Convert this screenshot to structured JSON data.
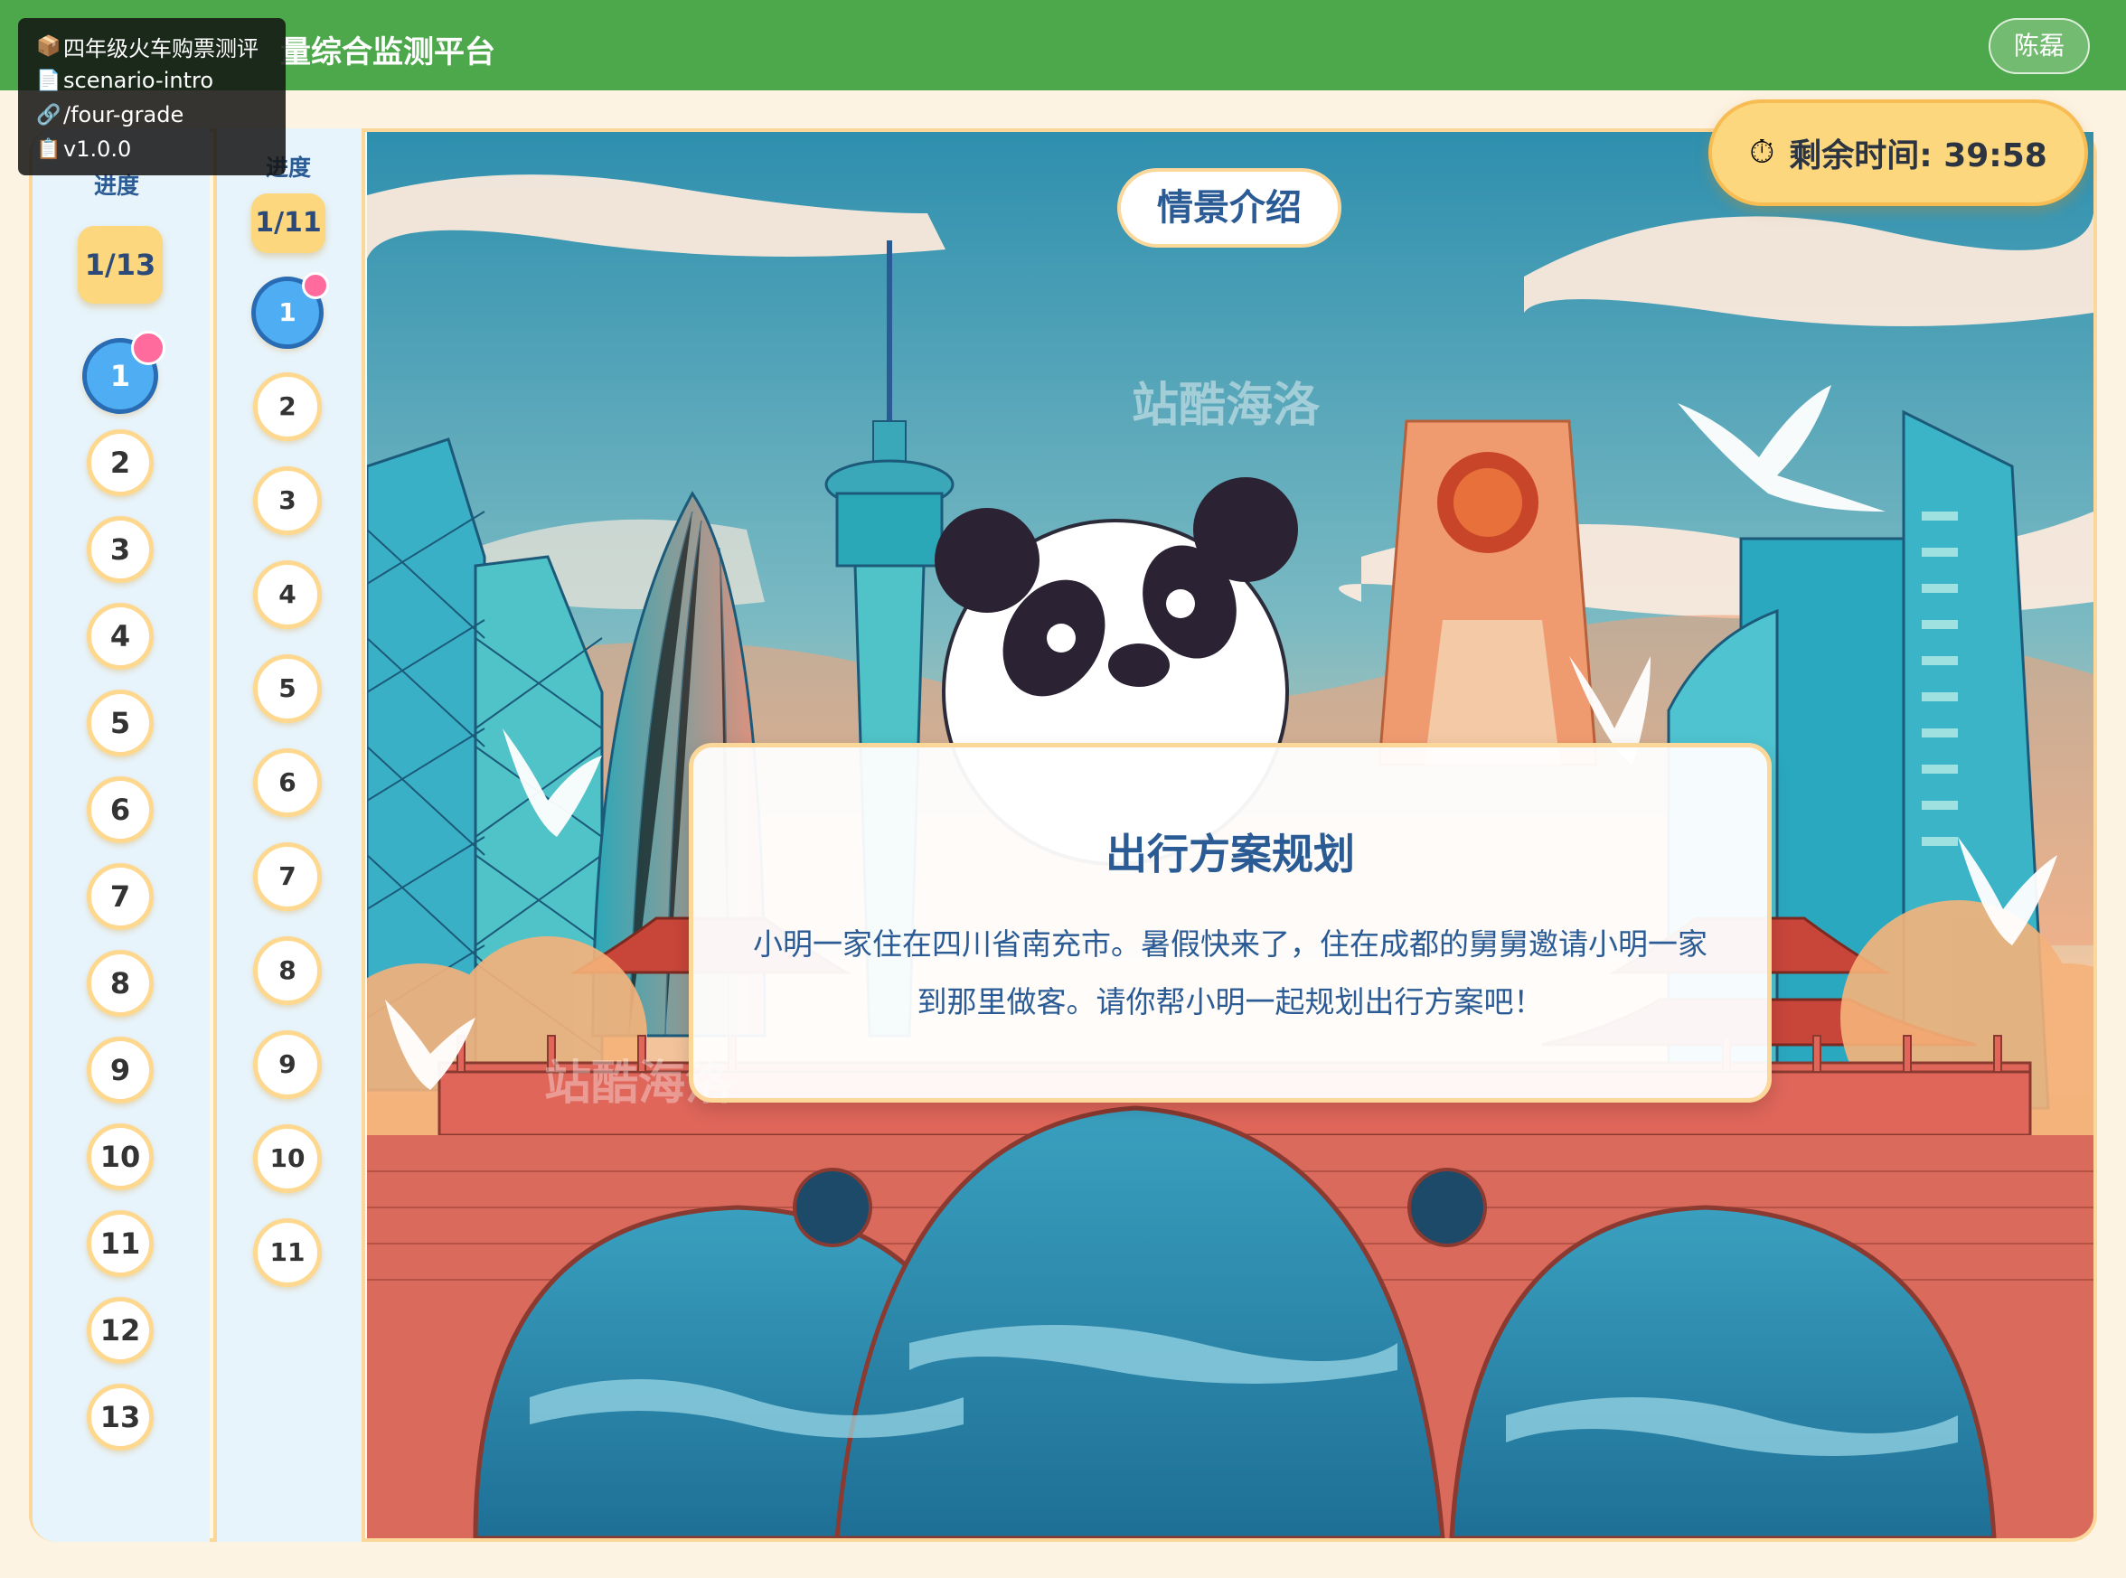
{
  "header": {
    "platform_title": "量综合监测平台",
    "user_name": "陈磊"
  },
  "info_overlay": {
    "rows": [
      {
        "icon": "package-icon",
        "glyph": "📦",
        "text": "四年级火车购票测评"
      },
      {
        "icon": "document-icon",
        "glyph": "📄",
        "text": "scenario-intro"
      },
      {
        "icon": "link-icon",
        "glyph": "🔗",
        "text": "/four-grade"
      },
      {
        "icon": "clipboard-icon",
        "glyph": "📋",
        "text": "v1.0.0"
      }
    ]
  },
  "progress_outer": {
    "label": "进度",
    "badge": "1/13",
    "steps": [
      "1",
      "2",
      "3",
      "4",
      "5",
      "6",
      "7",
      "8",
      "9",
      "10",
      "11",
      "12",
      "13"
    ],
    "current": 1
  },
  "progress_inner": {
    "label": "进度",
    "badge": "1/11",
    "steps": [
      "1",
      "2",
      "3",
      "4",
      "5",
      "6",
      "7",
      "8",
      "9",
      "10",
      "11"
    ],
    "current": 1
  },
  "scene": {
    "tag": "情景介绍",
    "watermark": "站酷海洛"
  },
  "timer": {
    "icon": "stopwatch-icon",
    "label": "剩余时间: 39:58"
  },
  "card": {
    "title": "出行方案规划",
    "body": "小明一家住在四川省南充市。暑假快来了，住在成都的舅舅邀请小明一家到那里做客。请你帮小明一起规划出行方案吧！"
  },
  "colors": {
    "header_green": "#4ca84a",
    "accent_yellow": "#fcd77e",
    "frame_border": "#fcd79a",
    "text_blue": "#2b5b94",
    "active_step": "#4faef3",
    "notify_dot": "#ff6b9d"
  }
}
